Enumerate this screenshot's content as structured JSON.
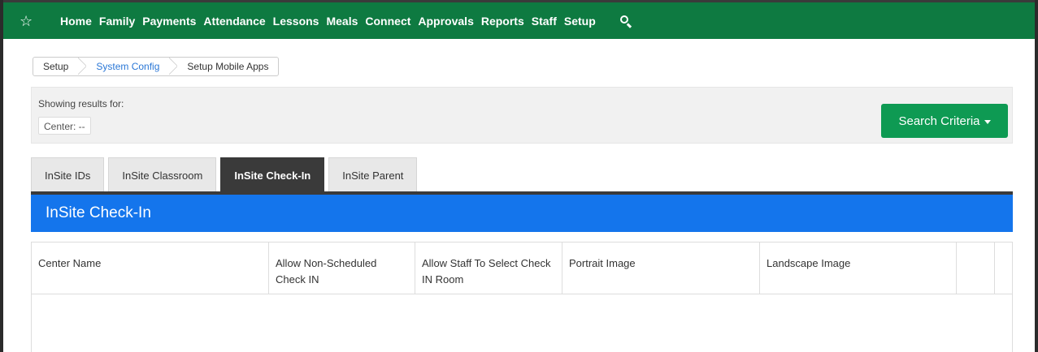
{
  "nav": {
    "star_icon": "star-icon",
    "items": [
      "Home",
      "Family",
      "Payments",
      "Attendance",
      "Lessons",
      "Meals",
      "Connect",
      "Approvals",
      "Reports",
      "Staff",
      "Setup"
    ],
    "search_icon": "search-icon",
    "background": "#0e7a41"
  },
  "breadcrumb": {
    "items": [
      "Setup",
      "System Config",
      "Setup Mobile Apps"
    ]
  },
  "results": {
    "label": "Showing results for:",
    "center_chip": "Center: --",
    "search_button": "Search Criteria",
    "search_button_color": "#0e9a53"
  },
  "tabs": {
    "items": [
      "InSite IDs",
      "InSite Classroom",
      "InSite Check-In",
      "InSite Parent"
    ],
    "active": "InSite Check-In"
  },
  "section": {
    "title": "InSite Check-In",
    "color": "#1475ec"
  },
  "table": {
    "columns": [
      "Center Name",
      "Allow Non-Scheduled Check IN",
      "Allow Staff To Select Check IN Room",
      "Portrait Image",
      "Landscape Image",
      "",
      ""
    ],
    "rows": []
  }
}
